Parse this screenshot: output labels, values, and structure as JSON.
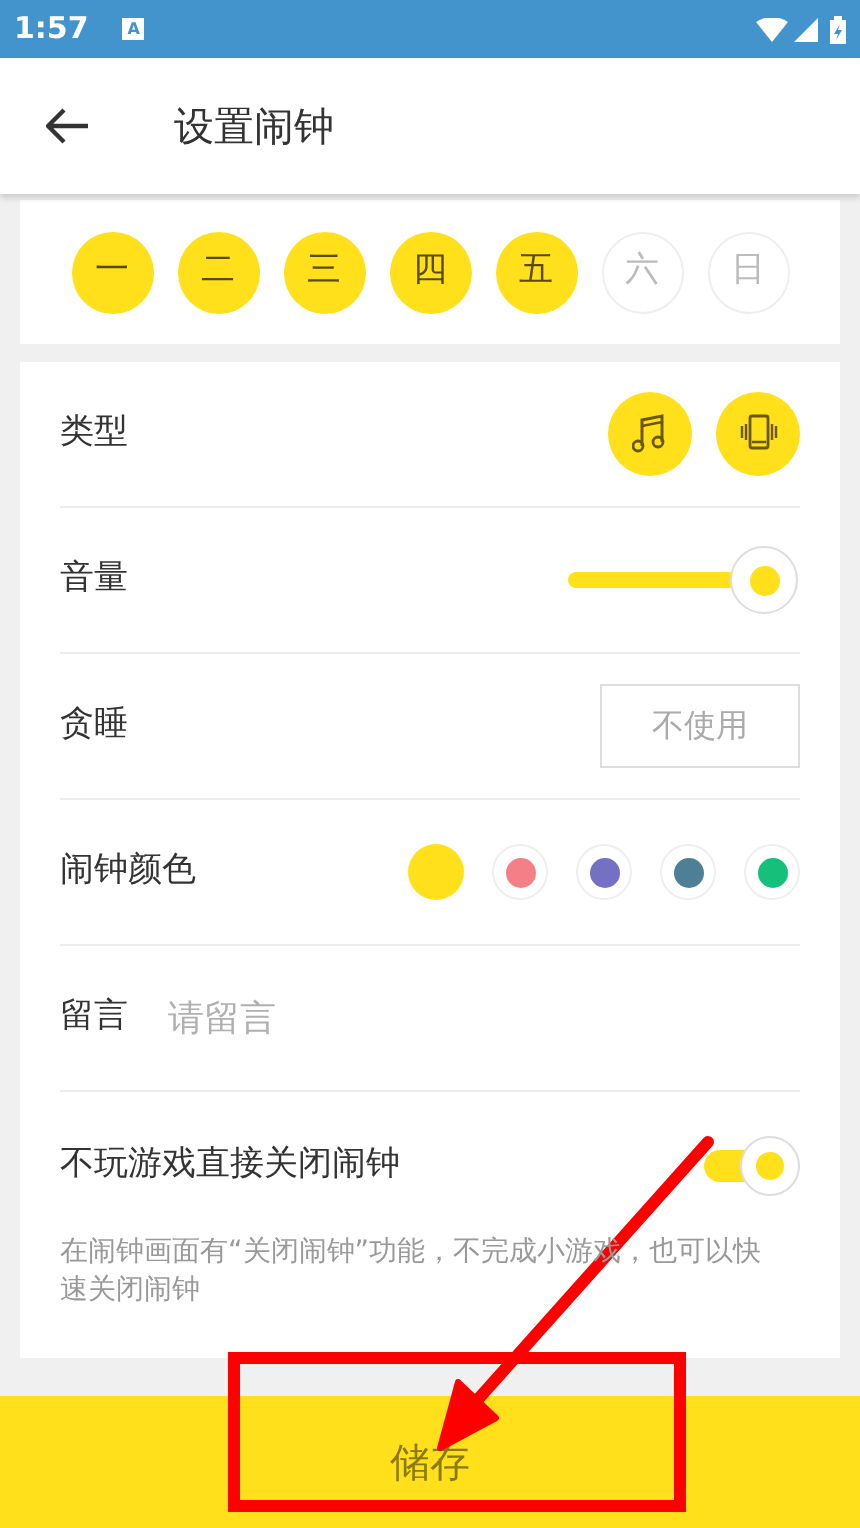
{
  "status_bar": {
    "time": "1:57",
    "notification": "A"
  },
  "app_bar": {
    "title": "设置闹钟"
  },
  "days": [
    {
      "label": "一",
      "selected": true
    },
    {
      "label": "二",
      "selected": true
    },
    {
      "label": "三",
      "selected": true
    },
    {
      "label": "四",
      "selected": true
    },
    {
      "label": "五",
      "selected": true
    },
    {
      "label": "六",
      "selected": false
    },
    {
      "label": "日",
      "selected": false
    }
  ],
  "settings": {
    "type": {
      "label": "类型",
      "options": [
        {
          "kind": "music",
          "selected": true
        },
        {
          "kind": "vibrate",
          "selected": true
        }
      ]
    },
    "volume": {
      "label": "音量",
      "level": 0.85
    },
    "snooze": {
      "label": "贪睡",
      "value": "不使用"
    },
    "color": {
      "label": "闹钟颜色",
      "options": [
        {
          "color": "#ffe01a",
          "selected": true
        },
        {
          "color": "#f57f86",
          "selected": false
        },
        {
          "color": "#7470c4",
          "selected": false
        },
        {
          "color": "#4f7f96",
          "selected": false
        },
        {
          "color": "#14c07a",
          "selected": false
        }
      ]
    },
    "message": {
      "label": "留言",
      "placeholder": "请留言"
    },
    "skip_game": {
      "label": "不玩游戏直接关闭闹钟",
      "on": true,
      "description": "在闹钟画面有“关闭闹钟”功能，不完成小游戏，也可以快速关闭闹钟"
    }
  },
  "save_button": {
    "label": "储存"
  }
}
